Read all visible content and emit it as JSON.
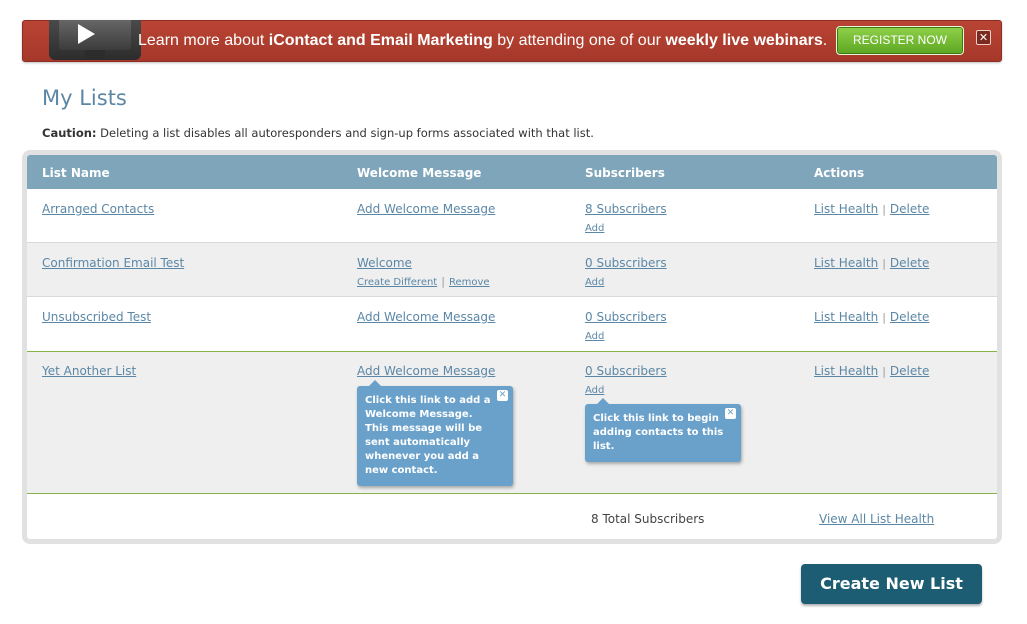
{
  "banner": {
    "text_pre": "Learn more about ",
    "text_bold1": "iContact and Email Marketing",
    "text_mid": " by attending one of our ",
    "text_bold2": "weekly live webinars",
    "text_post": ".",
    "register_label": "REGISTER NOW",
    "close_label": "✕",
    "accent_color": "#a5382a",
    "icon": "video-play-icon"
  },
  "page": {
    "title": "My Lists",
    "caution_label": "Caution:",
    "caution_text": " Deleting a list disables all autoresponders and sign-up forms associated with that list."
  },
  "table": {
    "headers": {
      "list_name": "List Name",
      "welcome": "Welcome Message",
      "subscribers": "Subscribers",
      "actions": "Actions"
    },
    "rows": [
      {
        "name": "Arranged Contacts",
        "welcome": "Add Welcome Message",
        "subscribers": "8 Subscribers",
        "add": "Add",
        "health": "List Health",
        "delete": "Delete"
      },
      {
        "name": "Confirmation Email Test",
        "welcome": "Welcome",
        "create_different": "Create Different",
        "remove": "Remove",
        "subscribers": "0 Subscribers",
        "add": "Add",
        "health": "List Health",
        "delete": "Delete"
      },
      {
        "name": "Unsubscribed Test",
        "welcome": "Add Welcome Message",
        "subscribers": "0 Subscribers",
        "add": "Add",
        "health": "List Health",
        "delete": "Delete"
      },
      {
        "name": "Yet Another List",
        "welcome": "Add Welcome Message",
        "subscribers": "0 Subscribers",
        "add": "Add",
        "health": "List Health",
        "delete": "Delete"
      }
    ],
    "separator": "|",
    "total": "8 Total Subscribers",
    "view_all": "View All List Health"
  },
  "tooltips": {
    "welcome": "Click this link to add a Welcome Message. This message will be sent automatically whenever you add a new contact.",
    "add": "Click this link to begin adding contacts to this list.",
    "close_label": "✕"
  },
  "create_button": "Create New List"
}
